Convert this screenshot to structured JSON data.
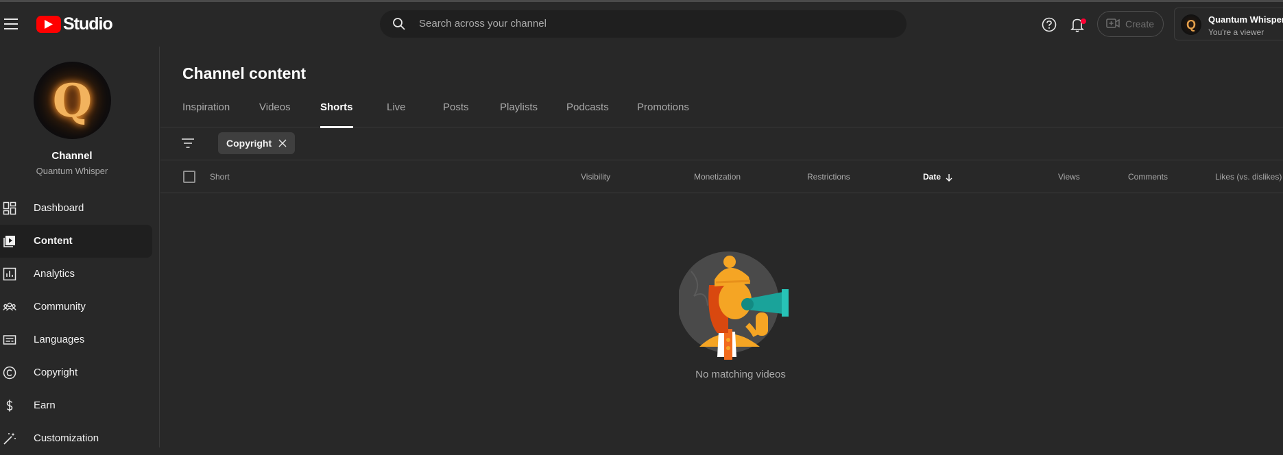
{
  "app": {
    "logo_text": "Studio"
  },
  "search": {
    "placeholder": "Search across your channel"
  },
  "header": {
    "create_label": "Create"
  },
  "account": {
    "name": "Quantum Whisper",
    "role": "You're a viewer",
    "avatar_letter": "Q"
  },
  "channel": {
    "title": "Channel",
    "name": "Quantum Whisper",
    "avatar_letter": "Q"
  },
  "sidebar": {
    "items": [
      {
        "label": "Dashboard",
        "icon": "dashboard-icon"
      },
      {
        "label": "Content",
        "icon": "content-icon",
        "active": true
      },
      {
        "label": "Analytics",
        "icon": "analytics-icon"
      },
      {
        "label": "Community",
        "icon": "community-icon"
      },
      {
        "label": "Languages",
        "icon": "languages-icon"
      },
      {
        "label": "Copyright",
        "icon": "copyright-icon"
      },
      {
        "label": "Earn",
        "icon": "dollar-icon"
      },
      {
        "label": "Customization",
        "icon": "magic-wand-icon"
      }
    ]
  },
  "main": {
    "title": "Channel content",
    "tabs": [
      {
        "label": "Inspiration"
      },
      {
        "label": "Videos"
      },
      {
        "label": "Shorts",
        "active": true
      },
      {
        "label": "Live"
      },
      {
        "label": "Posts"
      },
      {
        "label": "Playlists"
      },
      {
        "label": "Podcasts"
      },
      {
        "label": "Promotions"
      }
    ],
    "filter_chip": "Copyright",
    "columns": {
      "short": "Short",
      "visibility": "Visibility",
      "monetization": "Monetization",
      "restrictions": "Restrictions",
      "date": "Date",
      "views": "Views",
      "comments": "Comments",
      "likes": "Likes (vs. dislikes)"
    },
    "sort_column": "date",
    "sort_direction": "descending",
    "empty_state": "No matching videos"
  },
  "colors": {
    "brand": "#ff0000",
    "notification_dot": "#ff0033",
    "background": "#282828"
  }
}
